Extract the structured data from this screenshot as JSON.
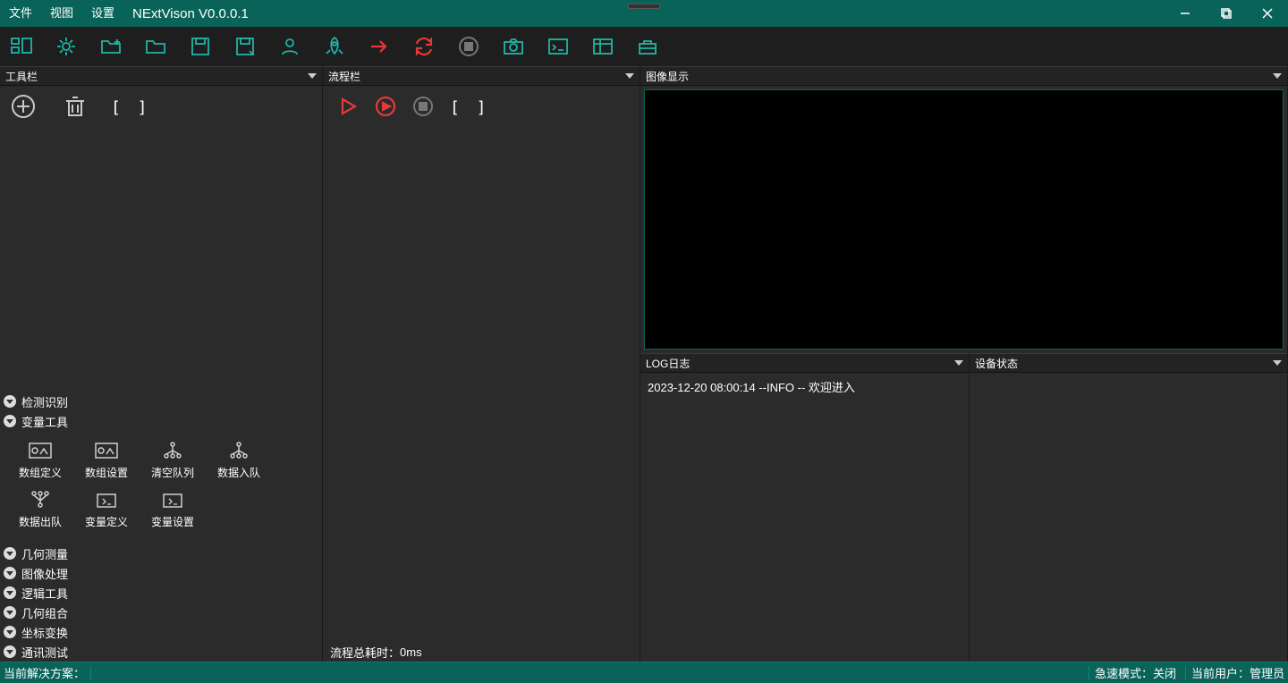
{
  "titlebar": {
    "menu": [
      "文件",
      "视图",
      "设置"
    ],
    "app_title": "NExtVison V0.0.0.1"
  },
  "panels": {
    "toolbox": {
      "title": "工具栏",
      "brackets": "[  ]"
    },
    "flow": {
      "title": "流程栏",
      "brackets": "[  ]"
    },
    "image_display": {
      "title": "图像显示"
    },
    "log": {
      "title": "LOG日志",
      "entry": "2023-12-20 08:00:14 --INFO -- 欢迎进入"
    },
    "device": {
      "title": "设备状态"
    }
  },
  "categories": {
    "c0": "检测识别",
    "c1": "变量工具",
    "c2": "几何测量",
    "c3": "图像处理",
    "c4": "逻辑工具",
    "c5": "几何组合",
    "c6": "坐标变换",
    "c7": "通讯测试"
  },
  "var_tools": {
    "t0": "数组定义",
    "t1": "数组设置",
    "t2": "清空队列",
    "t3": "数据入队",
    "t4": "数据出队",
    "t5": "变量定义",
    "t6": "变量设置"
  },
  "flow_footer": {
    "label": "流程总耗时：",
    "value": "0ms"
  },
  "statusbar": {
    "solution_label": "当前解决方案：",
    "solution_value": "",
    "fast_mode_label": "急速模式：",
    "fast_mode_value": "关闭",
    "user_label": "当前用户：",
    "user_value": "管理员"
  }
}
